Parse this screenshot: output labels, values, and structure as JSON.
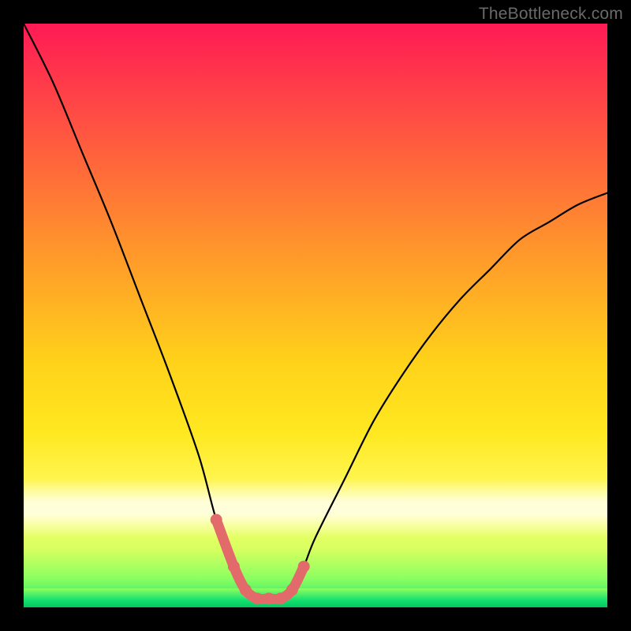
{
  "watermark": "TheBottleneck.com",
  "chart_data": {
    "type": "line",
    "title": "",
    "xlabel": "",
    "ylabel": "",
    "xlim": [
      0,
      1
    ],
    "ylim": [
      0,
      1
    ],
    "background_gradient": {
      "stops": [
        {
          "pos": 0.0,
          "color": "#ff1a55"
        },
        {
          "pos": 0.25,
          "color": "#ff6a3a"
        },
        {
          "pos": 0.55,
          "color": "#ffd21a"
        },
        {
          "pos": 0.8,
          "color": "#fff85a"
        },
        {
          "pos": 0.95,
          "color": "#8cff60"
        },
        {
          "pos": 1.0,
          "color": "#18e070"
        }
      ]
    },
    "series": [
      {
        "name": "bottleneck-curve",
        "color": "#000000",
        "x": [
          0.0,
          0.05,
          0.1,
          0.15,
          0.2,
          0.25,
          0.3,
          0.33,
          0.36,
          0.38,
          0.4,
          0.42,
          0.44,
          0.46,
          0.48,
          0.5,
          0.55,
          0.6,
          0.65,
          0.7,
          0.75,
          0.8,
          0.85,
          0.9,
          0.95,
          1.0
        ],
        "y": [
          1.0,
          0.9,
          0.78,
          0.66,
          0.53,
          0.4,
          0.26,
          0.15,
          0.07,
          0.03,
          0.015,
          0.015,
          0.015,
          0.03,
          0.07,
          0.12,
          0.22,
          0.32,
          0.4,
          0.47,
          0.53,
          0.58,
          0.63,
          0.66,
          0.69,
          0.71
        ]
      },
      {
        "name": "highlight-segment",
        "color": "#e26a6a",
        "thick": true,
        "x": [
          0.33,
          0.36,
          0.38,
          0.4,
          0.42,
          0.44,
          0.46,
          0.48
        ],
        "y": [
          0.15,
          0.07,
          0.03,
          0.015,
          0.015,
          0.015,
          0.03,
          0.07
        ]
      }
    ]
  }
}
